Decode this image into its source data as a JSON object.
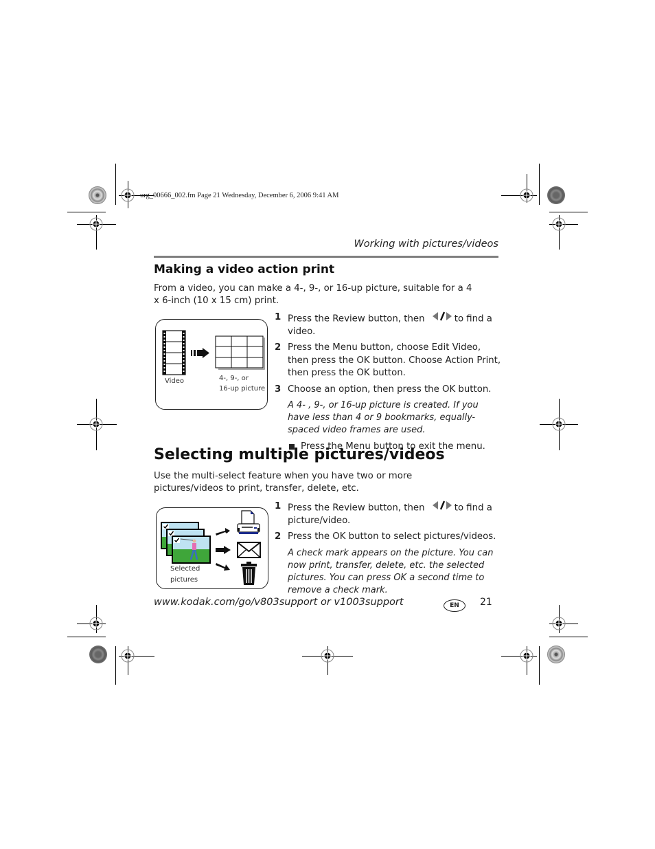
{
  "slug": "urg_00666_002.fm  Page 21  Wednesday, December 6, 2006  9:41 AM",
  "running_head": "Working with pictures/videos",
  "section1": {
    "heading": "Making a video action print",
    "intro": "From a video, you can make a 4-, 9-, or 16-up picture, suitable for a 4 x 6-inch (10 x 15 cm) print.",
    "figure": {
      "video_label": "Video",
      "output_label_line1": "4-, 9-, or",
      "output_label_line2": "16-up picture"
    },
    "steps": [
      {
        "num": "1",
        "before": "Press the Review button, then",
        "icon": "left-right-arrows-icon",
        "after": "to find a video."
      },
      {
        "num": "2",
        "text": "Press the Menu button, choose Edit Video, then press the OK button. Choose Action Print, then press the OK button."
      },
      {
        "num": "3",
        "text": "Choose an option, then press the OK button."
      }
    ],
    "note": "A 4- , 9-, or 16-up picture is created. If you have less than 4 or 9 bookmarks, equally-spaced video frames are used.",
    "bullet": "Press the Menu button to exit the menu."
  },
  "section2": {
    "heading": "Selecting multiple pictures/videos",
    "intro": "Use the multi-select feature when you have two or more pictures/videos to print, transfer, delete, etc.",
    "figure": {
      "label_line1": "Selected",
      "label_line2": "pictures",
      "actions": [
        "print",
        "email",
        "delete"
      ]
    },
    "steps": [
      {
        "num": "1",
        "before": "Press the Review button, then",
        "icon": "left-right-arrows-icon",
        "after": "to find a picture/video."
      },
      {
        "num": "2",
        "text": "Press the OK button to select pictures/videos."
      }
    ],
    "note": "A check mark appears on the picture. You can now print, transfer, delete, etc. the selected pictures. You can press OK a second time to remove a check mark."
  },
  "footer": {
    "url": "www.kodak.com/go/v803support or v1003support",
    "lang_badge": "EN",
    "page_number": "21"
  },
  "colors": {
    "rule": "#808080",
    "text": "#222222",
    "printer_icon_accent": "#1a2a8a",
    "photo_sky": "#bfe3f2",
    "photo_grass": "#3fa63a"
  }
}
